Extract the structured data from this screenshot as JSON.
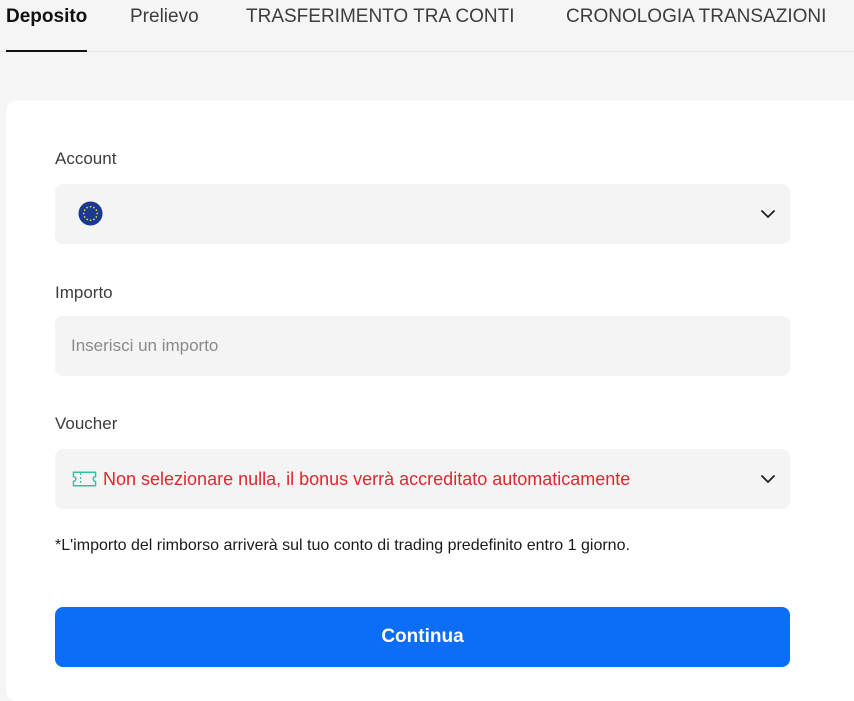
{
  "tabs": [
    {
      "label": "Deposito",
      "active": true
    },
    {
      "label": "Prelievo",
      "active": false
    },
    {
      "label": "TRASFERIMENTO TRA CONTI",
      "active": false
    },
    {
      "label": "CRONOLOGIA TRANSAZIONI",
      "active": false
    }
  ],
  "form": {
    "account_label": "Account",
    "account_icon": "eu-flag-icon",
    "amount_label": "Importo",
    "amount_placeholder": "Inserisci un importo",
    "voucher_label": "Voucher",
    "voucher_icon": "ticket-icon",
    "voucher_value": "Non selezionare nulla, il bonus verrà accreditato automaticamente",
    "note": "*L'importo del rimborso arriverà sul tuo conto di trading predefinito entro 1 giorno.",
    "submit_label": "Continua"
  },
  "colors": {
    "primary": "#0c6ef6",
    "voucher_text": "#e0262e",
    "voucher_icon": "#2ec4a0",
    "eu_blue": "#1a3a8f",
    "eu_star": "#f4d03f"
  }
}
